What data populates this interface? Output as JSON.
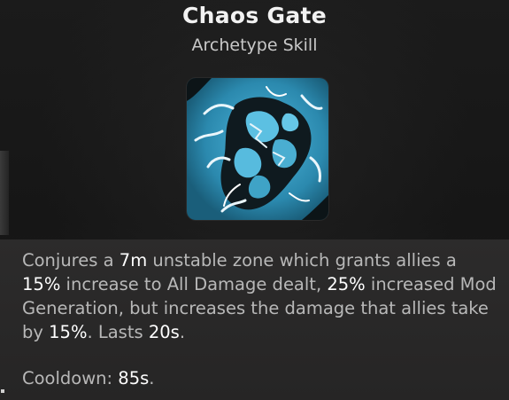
{
  "skill": {
    "name": "Chaos Gate",
    "type": "Archetype Skill",
    "icon": "chaos-gate-skill-icon"
  },
  "description": {
    "p1": "Conjures a ",
    "v1": "7m",
    "p2": " unstable zone which grants allies a ",
    "v2": "15%",
    "p3": " increase to All Damage dealt, ",
    "v3": "25%",
    "p4": " increased Mod Generation, but increases the damage that allies take by ",
    "v4": "15%",
    "p5": ". Lasts ",
    "v5": "20s",
    "p6": "."
  },
  "cooldown": {
    "label": "Cooldown: ",
    "value": "85s",
    "suffix": "."
  },
  "colors": {
    "highlight": "#ffffff",
    "body_text": "#b8b8b8",
    "icon_blue": "#3fa3c6"
  }
}
